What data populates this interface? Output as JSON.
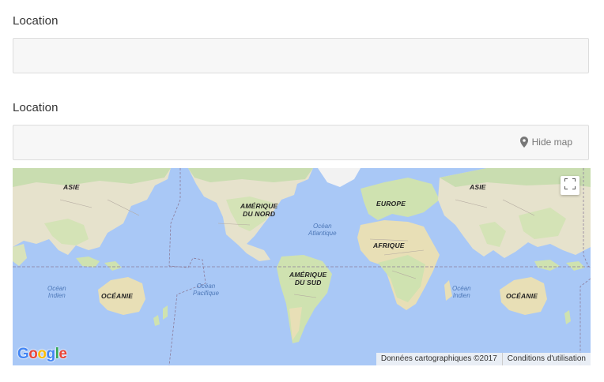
{
  "form": {
    "location_label_1": "Location",
    "location_value_1": "",
    "location_label_2": "Location",
    "location_value_2": "",
    "hide_map_label": "Hide map"
  },
  "map": {
    "labels": {
      "asia_left": "ASIE",
      "asia_right": "ASIE",
      "north_america": "AMÉRIQUE\nDU NORD",
      "europe": "EUROPE",
      "africa": "AFRIQUE",
      "south_america": "AMÉRIQUE\nDU SUD",
      "oceania_left": "OCÉANIE",
      "oceania_right": "OCÉANIE"
    },
    "oceans": {
      "atlantic": "Océan\nAtlantique",
      "pacific": "Océan\nPacifique",
      "indian_left": "Océan\nIndien",
      "indian_right": "Océan\nIndien"
    },
    "logo_text": "Google",
    "attribution_data": "Données cartographiques ©2017",
    "attribution_terms": "Conditions d'utilisation",
    "colors": {
      "water": "#a9c8f6",
      "land": "#e8e4d0",
      "vegetation": "#cfe2b0",
      "border": "#999999"
    }
  }
}
